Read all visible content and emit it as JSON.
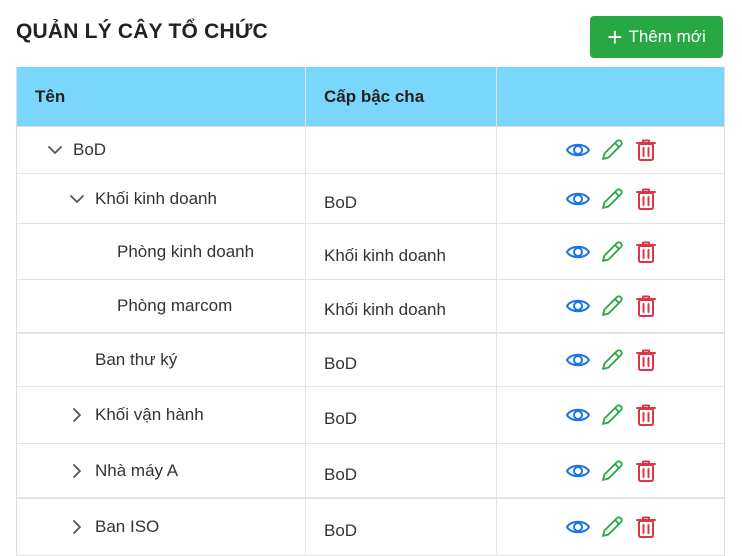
{
  "page": {
    "title": "QUẢN LÝ CÂY TỔ CHỨC",
    "add_button_label": "Thêm mới"
  },
  "colors": {
    "header_bg": "#7ad7fb",
    "add_button_bg": "#28a745",
    "view_icon": "#1a73e8",
    "edit_icon": "#28a745",
    "delete_icon": "#dc3545"
  },
  "table": {
    "columns": [
      "Tên",
      "Cấp bậc cha",
      ""
    ],
    "rows": [
      {
        "name": "BoD",
        "parent": "",
        "depth": 0,
        "toggle": "expanded",
        "height": 46
      },
      {
        "name": "Khối kinh doanh",
        "parent": "BoD",
        "depth": 1,
        "toggle": "expanded",
        "height": 49
      },
      {
        "name": "Phòng kinh doanh",
        "parent": "Khối kinh doanh",
        "depth": 2,
        "toggle": "none",
        "height": 55
      },
      {
        "name": "Phòng marcom",
        "parent": "Khối kinh doanh",
        "depth": 2,
        "toggle": "none",
        "height": 52
      },
      {
        "name": "Ban thư ký",
        "parent": "BoD",
        "depth": 1,
        "toggle": "none",
        "height": 52
      },
      {
        "name": "Khối vận hành",
        "parent": "BoD",
        "depth": 1,
        "toggle": "collapsed",
        "height": 56
      },
      {
        "name": "Nhà máy A",
        "parent": "BoD",
        "depth": 1,
        "toggle": "collapsed",
        "height": 53
      },
      {
        "name": "Ban ISO",
        "parent": "BoD",
        "depth": 1,
        "toggle": "collapsed",
        "height": 56
      }
    ],
    "row_actions": [
      "view-icon",
      "edit-icon",
      "delete-icon"
    ]
  }
}
